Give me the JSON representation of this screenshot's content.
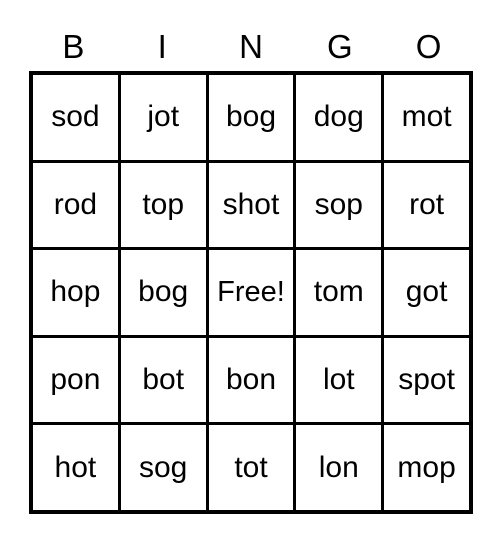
{
  "card": {
    "title": "BINGO",
    "columns": [
      "B",
      "I",
      "N",
      "G",
      "O"
    ],
    "free_space_label": "Free!",
    "colors": {
      "background": "#ffffff",
      "grid_line": "#000000",
      "text": "#000000"
    },
    "rows": [
      {
        "cells": [
          "sod",
          "jot",
          "bog",
          "dog",
          "mot"
        ]
      },
      {
        "cells": [
          "rod",
          "top",
          "shot",
          "sop",
          "rot"
        ]
      },
      {
        "cells": [
          "hop",
          "bog",
          "Free!",
          "tom",
          "got"
        ]
      },
      {
        "cells": [
          "pon",
          "bot",
          "bon",
          "lot",
          "spot"
        ]
      },
      {
        "cells": [
          "hot",
          "sog",
          "tot",
          "lon",
          "mop"
        ]
      }
    ]
  }
}
